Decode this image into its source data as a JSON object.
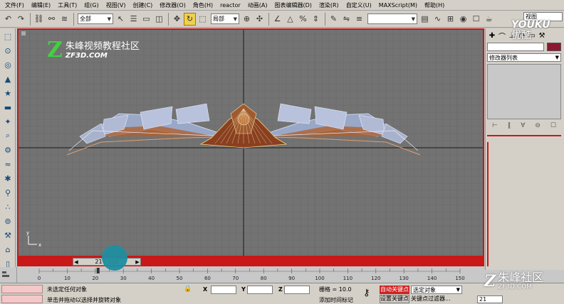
{
  "menu": [
    "文件(F)",
    "编辑(E)",
    "工具(T)",
    "组(G)",
    "视图(V)",
    "创建(C)",
    "修改器(O)",
    "角色(H)",
    "reactor",
    "动画(A)",
    "图表编辑器(D)",
    "渲染(R)",
    "自定义(U)",
    "MAXScript(M)",
    "帮助(H)"
  ],
  "toolbar": {
    "selection_filter": "全部",
    "ref_coord": "局部",
    "named_selection": "",
    "view_label": "视图"
  },
  "viewport": {
    "logo_z": "Z",
    "logo_cn": "朱峰视频教程社区",
    "logo_en": "ZF3D.COM",
    "axis_label_x": "x",
    "axis_label_y": "y"
  },
  "time_slider": {
    "label": "21 / 150",
    "current": 21,
    "total": 150
  },
  "track": {
    "ticks": [
      "0",
      "10",
      "20",
      "30",
      "40",
      "50",
      "60",
      "70",
      "80",
      "90",
      "100",
      "110",
      "120",
      "130",
      "140",
      "150"
    ]
  },
  "status": {
    "line1": "未选定任何对象",
    "line2": "单击并拖动以选择并旋转对象",
    "x_label": "X",
    "y_label": "Y",
    "z_label": "Z",
    "grid": "栅格 = 10.0",
    "add_time_tag": "添加时间标记",
    "auto_key": "自动关键点",
    "set_key": "设置关键点",
    "selected_object": "选定对象",
    "key_filter": "关键点过滤器...",
    "frame": "21"
  },
  "command_panel": {
    "modifier_list": "修改器列表",
    "object_color": "#8a1830"
  },
  "watermark": {
    "youku_1": "YOUKU",
    "youku_2": "优酷",
    "br_z": "Z",
    "br_cn": "朱峰社区",
    "br_en": "ZF3D.COM"
  },
  "colors": {
    "active_border": "#c81818",
    "viewport_bg": "#737373",
    "grid_line": "#6a6a6a",
    "axis_line": "#1a1a1a",
    "logo_green": "#42d040"
  }
}
